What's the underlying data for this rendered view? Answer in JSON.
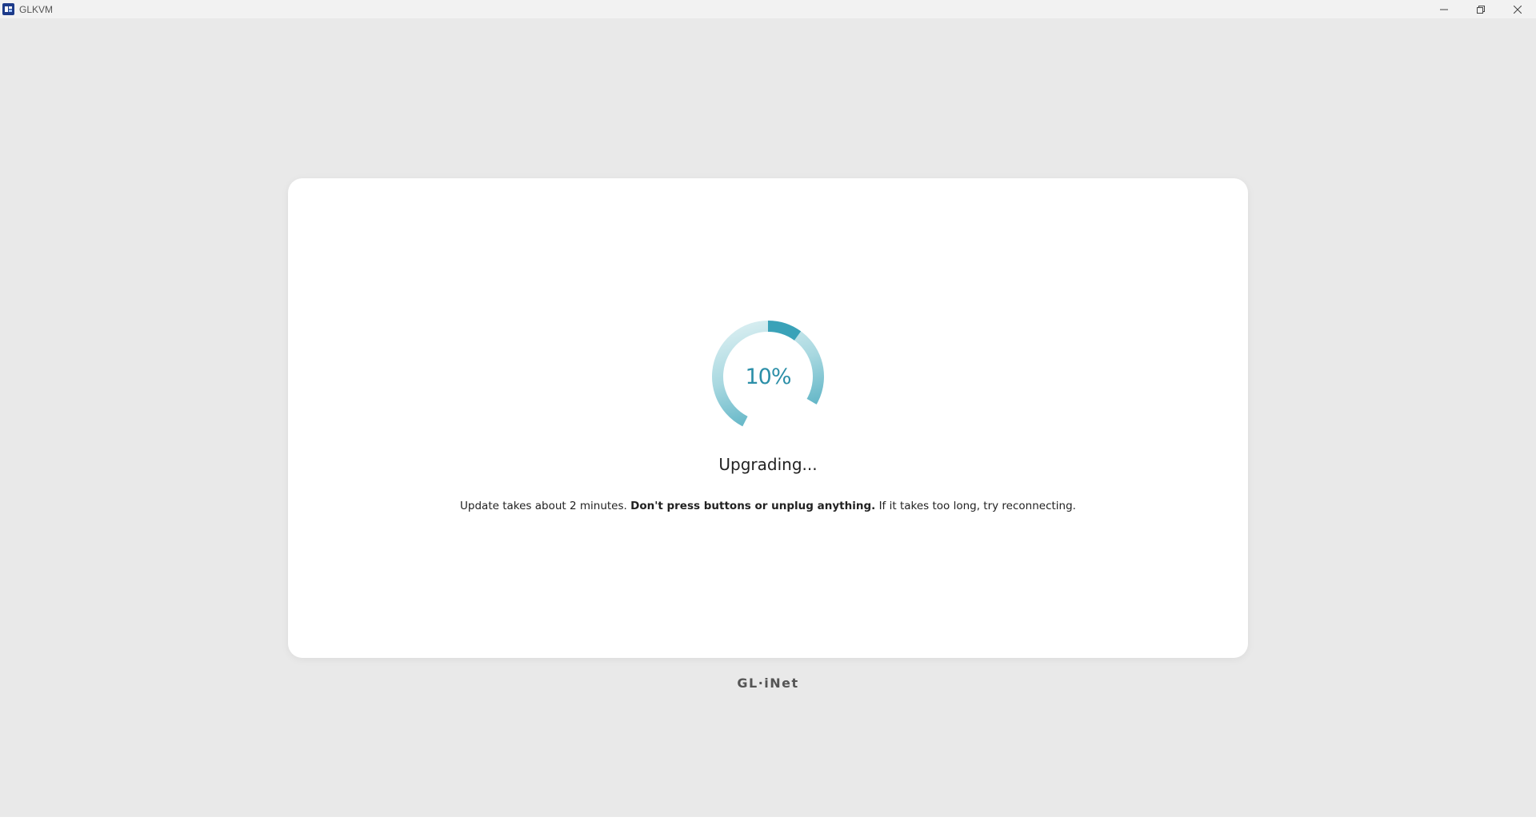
{
  "window": {
    "title": "GLKVM"
  },
  "upgrade": {
    "progress_percent": 10,
    "progress_label": "10%",
    "title": "Upgrading...",
    "message_start": "Update takes about 2 minutes.",
    "message_bold": "Don't press buttons or unplug anything.",
    "message_end": "If it takes too long, try reconnecting."
  },
  "brand": {
    "logo_text": "GL·iNet"
  },
  "colors": {
    "accent": "#2c8fa8",
    "ring_start": "#bfe3e9",
    "ring_end": "#3aa2b8",
    "background": "#e9e9e9",
    "card": "#ffffff"
  },
  "icons": {
    "app": "glkvm-app-icon",
    "minimize": "minimize-icon",
    "maximize": "maximize-icon",
    "close": "close-icon"
  }
}
